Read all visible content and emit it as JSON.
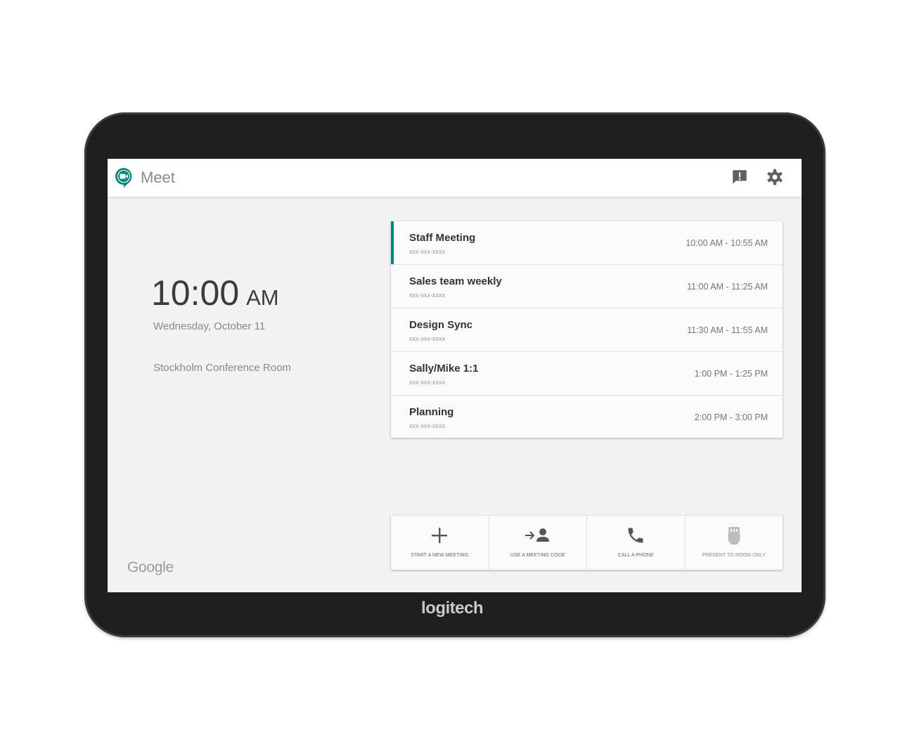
{
  "device": {
    "brand": "logitech"
  },
  "header": {
    "app_name": "Meet"
  },
  "colors": {
    "accent": "#00897b",
    "meet_green": "#00832d"
  },
  "icons": {
    "logo": "meet-logo-icon",
    "feedback": "feedback-icon",
    "settings": "gear-icon"
  },
  "clock": {
    "time": "10:00",
    "ampm": "AM",
    "date": "Wednesday, October 11"
  },
  "room": {
    "name": "Stockholm Conference Room"
  },
  "footer": {
    "logo_text": "Google"
  },
  "meetings": [
    {
      "title": "Staff Meeting",
      "code": "xxx-xxx-xxxx",
      "time": "10:00 AM - 10:55 AM",
      "active": true
    },
    {
      "title": "Sales team weekly",
      "code": "xxx-xxx-xxxx",
      "time": "11:00 AM - 11:25 AM"
    },
    {
      "title": "Design Sync",
      "code": "xxx-xxx-xxxx",
      "time": "11:30 AM - 11:55 AM"
    },
    {
      "title": "Sally/Mike 1:1",
      "code": "xxx-xxx-xxxx",
      "time": "1:00 PM - 1:25 PM"
    },
    {
      "title": "Planning",
      "code": "xxx-xxx-xxxx",
      "time": "2:00 PM - 3:00 PM"
    }
  ],
  "actions": [
    {
      "label": "START A NEW MEETING",
      "icon": "plus-icon"
    },
    {
      "label": "USE A MEETING CODE",
      "icon": "join-person-icon"
    },
    {
      "label": "CALL A PHONE",
      "icon": "phone-icon"
    },
    {
      "label": "PRESENT TO ROOM ONLY",
      "icon": "hdmi-icon"
    }
  ]
}
